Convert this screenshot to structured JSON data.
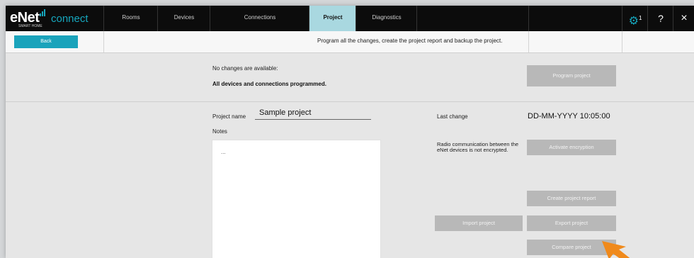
{
  "brand": {
    "name": "eNet",
    "sub": "connect",
    "tagline": "SMART HOME"
  },
  "nav": {
    "tabs": [
      {
        "label": "Rooms",
        "active": false
      },
      {
        "label": "Devices",
        "active": false
      },
      {
        "label": "Connections",
        "active": false
      },
      {
        "label": "Project",
        "active": true
      },
      {
        "label": "Diagnostics",
        "active": false
      }
    ],
    "settings_badge": "1",
    "help_label": "?",
    "close_label": "×"
  },
  "subheader": {
    "back_label": "Back",
    "message": "Program all the changes, create the project report and backup the project."
  },
  "status": {
    "no_changes": "No changes are available:",
    "all_programmed": "All devices and connections programmed.",
    "program_button": "Program project"
  },
  "project": {
    "name_label": "Project name",
    "name_value": "Sample project",
    "notes_label": "Notes",
    "notes_value": "...",
    "last_change_label": "Last change",
    "last_change_value": "DD-MM-YYYY  10:05:00"
  },
  "encryption": {
    "message": "Radio communication between the eNet devices is not encrypted.",
    "activate_button": "Activate encryption"
  },
  "actions": {
    "create_report": "Create project report",
    "import": "Import project",
    "export": "Export project",
    "compare": "Compare project"
  },
  "colors": {
    "accent": "#1aa3bb",
    "active_tab": "#a9d8e0",
    "nav_bg": "#0c0c0c",
    "disabled_button": "#b8b8b8",
    "pointer": "#f08a1c"
  }
}
